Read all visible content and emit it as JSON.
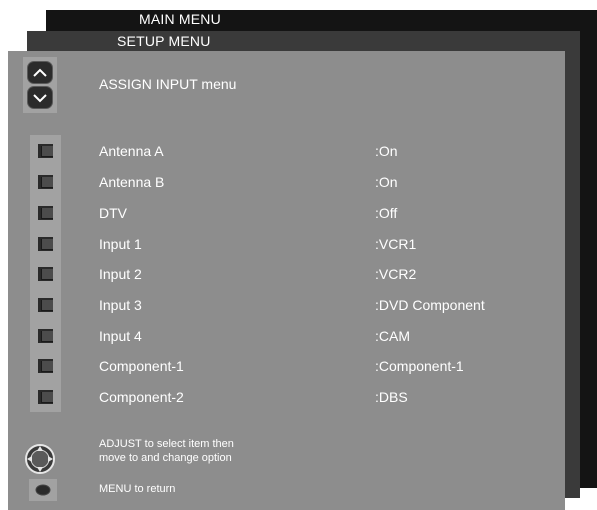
{
  "main_menu": {
    "title": "MAIN MENU"
  },
  "setup_menu": {
    "title": "SETUP MENU"
  },
  "assign_input": {
    "title": "ASSIGN INPUT menu",
    "items": [
      {
        "label": "Antenna A",
        "value": ":On"
      },
      {
        "label": "Antenna B",
        "value": ":On"
      },
      {
        "label": "DTV",
        "value": ":Off"
      },
      {
        "label": "Input 1",
        "value": ":VCR1"
      },
      {
        "label": "Input 2",
        "value": ":VCR2"
      },
      {
        "label": "Input 3",
        "value": ":DVD Component"
      },
      {
        "label": "Input 4",
        "value": ":CAM"
      },
      {
        "label": "Component-1",
        "value": ":Component-1"
      },
      {
        "label": "Component-2",
        "value": ":DBS"
      }
    ]
  },
  "help": {
    "adjust_line1": "ADJUST to select item then",
    "adjust_line2": "move to and change option",
    "menu_return": "MENU to return",
    "adjust_icon": "adjust-joystick-icon",
    "menu_icon": "menu-button-icon"
  },
  "colors": {
    "main_layer": "#141414",
    "setup_layer": "#3a3a3a",
    "assign_layer": "#8d8d8d",
    "text": "#ffffff"
  }
}
